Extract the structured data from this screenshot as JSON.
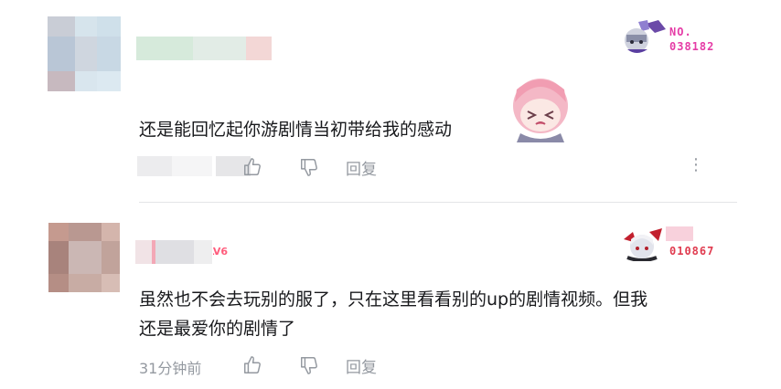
{
  "comments": [
    {
      "text": "还是能回忆起你游剧情当初带给我的感动",
      "time": "",
      "reply_label": "回复",
      "fan_badge": {
        "label": "NO.",
        "number": "038182",
        "color": "#e53ca6"
      },
      "more_label": "⋮"
    },
    {
      "text_line1": "虽然也不会去玩别的服了，只在这里看看别的up的剧情视频。但我",
      "text_line2": "还是最爱你的剧情了",
      "time": "31分钟前",
      "reply_label": "回复",
      "level_tag": "LV6",
      "fan_badge": {
        "number": "010867",
        "color": "#e03b4f"
      }
    }
  ],
  "icons": {
    "like": "thumb-up-icon",
    "dislike": "thumb-down-icon",
    "more": "more-vertical-icon"
  }
}
